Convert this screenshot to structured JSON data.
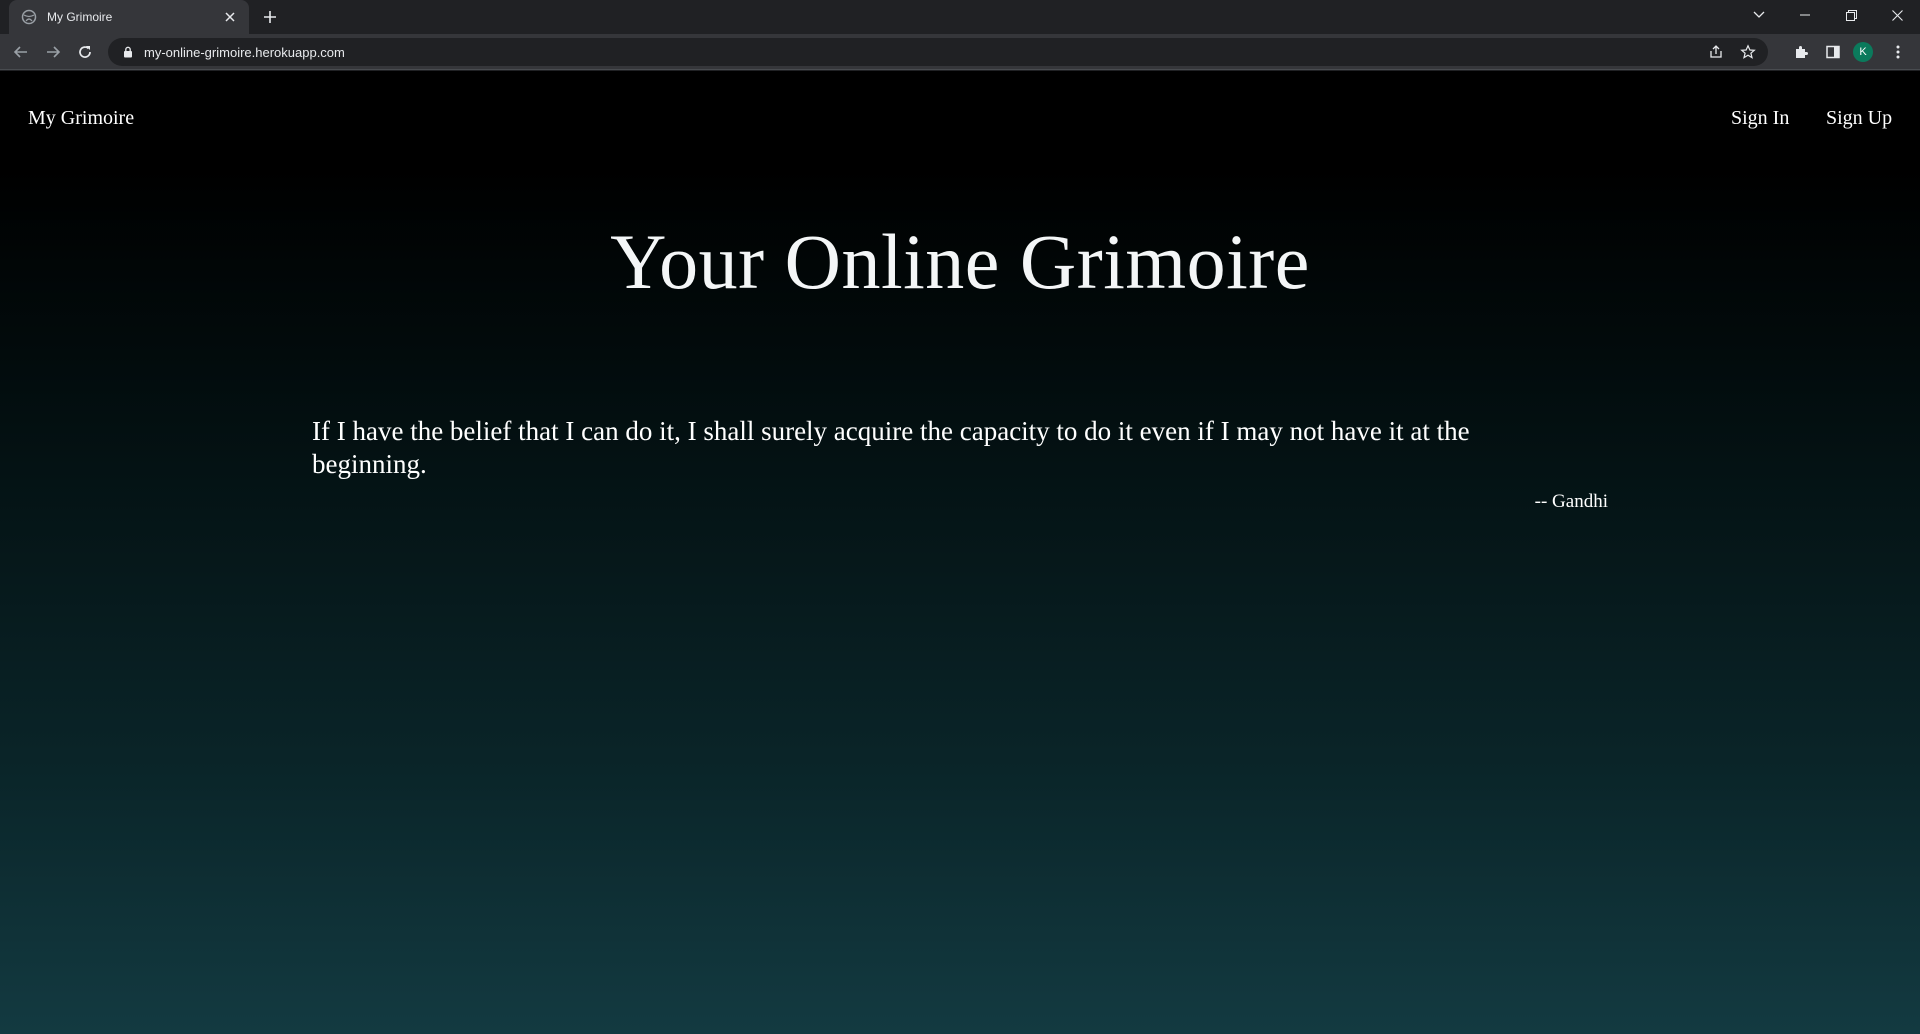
{
  "browser": {
    "tab_title": "My Grimoire",
    "url": "my-online-grimoire.herokuapp.com",
    "profile_initial": "K",
    "profile_color": "#0b7a5c"
  },
  "nav": {
    "brand": "My Grimoire",
    "sign_in": "Sign In",
    "sign_up": "Sign Up"
  },
  "hero": {
    "title": "Your Online Grimoire"
  },
  "quote": {
    "text": "If I have the belief that I can do it, I shall surely acquire the capacity to do it even if I may not have it at the beginning.",
    "author": "-- Gandhi"
  },
  "icons": [
    "globe-icon",
    "close-icon",
    "plus-icon",
    "chevron-down-icon",
    "minimize-icon",
    "restore-icon",
    "window-close-icon",
    "back-icon",
    "forward-icon",
    "reload-icon",
    "lock-icon",
    "share-icon",
    "star-icon",
    "extensions-icon",
    "side-panel-icon",
    "menu-icon"
  ]
}
